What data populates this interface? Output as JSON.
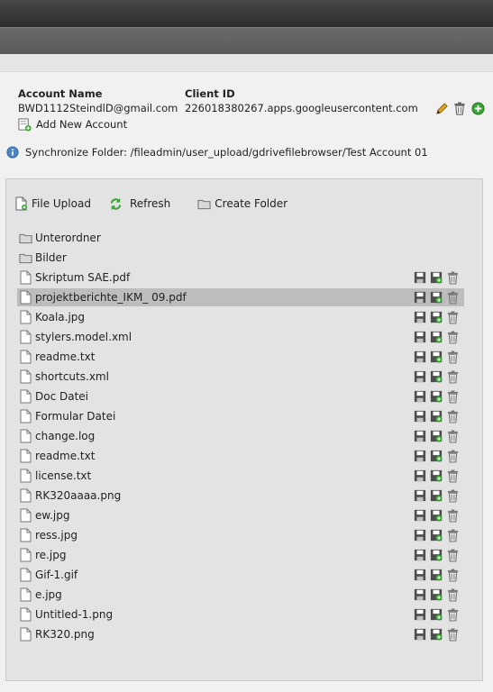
{
  "account": {
    "name_header": "Account Name",
    "name_value": "BWD1112SteindlD@gmail.com",
    "client_header": "Client ID",
    "client_value": "226018380267.apps.googleusercontent.com",
    "add_label": "Add New Account"
  },
  "sync": {
    "text": "Synchronize Folder: /fileadmin/user_upload/gdrivefilebrowser/Test Account 01"
  },
  "toolbar": {
    "upload_label": "File Upload",
    "refresh_label": "Refresh",
    "create_label": "Create Folder"
  },
  "folders": [
    {
      "name": "Unterordner"
    },
    {
      "name": "Bilder"
    }
  ],
  "files": [
    {
      "name": "Skriptum SAE.pdf"
    },
    {
      "name": "projektberichte_IKM_ 09.pdf"
    },
    {
      "name": "Koala.jpg"
    },
    {
      "name": "stylers.model.xml"
    },
    {
      "name": "readme.txt"
    },
    {
      "name": "shortcuts.xml"
    },
    {
      "name": "Doc Datei"
    },
    {
      "name": "Formular Datei"
    },
    {
      "name": "change.log"
    },
    {
      "name": "readme.txt"
    },
    {
      "name": "license.txt"
    },
    {
      "name": "RK320aaaa.png"
    },
    {
      "name": "ew.jpg"
    },
    {
      "name": "ress.jpg"
    },
    {
      "name": "re.jpg"
    },
    {
      "name": "Gif-1.gif"
    },
    {
      "name": "e.jpg"
    },
    {
      "name": "Untitled-1.png"
    },
    {
      "name": "RK320.png"
    }
  ],
  "selected_file_index": 1,
  "colors": {
    "topbar": "#3a3a3a",
    "panel": "#e3e3e3",
    "selected_row": "#bdbdbd",
    "add_green": "#3aa335",
    "info_blue": "#4a86c8",
    "edit_yellow": "#e2a81c"
  }
}
